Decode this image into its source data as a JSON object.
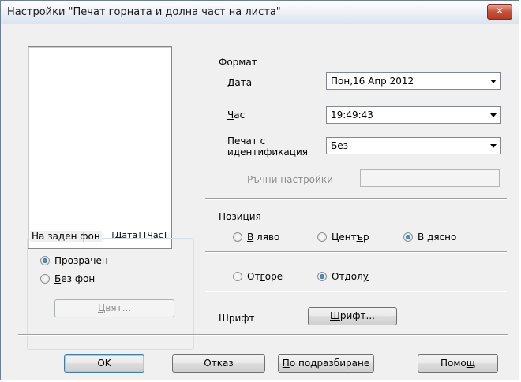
{
  "window": {
    "title": "Настройки \"Печат горната и долна част на листа\"",
    "close_label": "✕"
  },
  "preview": {
    "text": "[Дата] [Час]"
  },
  "background": {
    "label": "На заден фон",
    "options": [
      {
        "pre": "Прозрач",
        "u": "е",
        "post": "н",
        "selected": true
      },
      {
        "pre": "",
        "u": "Б",
        "post": "ез фон",
        "selected": false
      }
    ],
    "color_button": {
      "pre": "",
      "u": "Ц",
      "post": "вят..."
    }
  },
  "format": {
    "label": "Формат",
    "date": {
      "pre": "",
      "u": "Д",
      "post": "ата",
      "value": "Пон,16 Апр 2012"
    },
    "time": {
      "pre": "",
      "u": "Ч",
      "post": "ас",
      "value": "19:49:43"
    },
    "identification": {
      "label": "Печат с\nидентификация",
      "value": "Без"
    },
    "manual": {
      "pre": "Ръчни нас",
      "u": "т",
      "post": "ройки",
      "value": ""
    }
  },
  "position": {
    "label": "Позиция",
    "horizontal": [
      {
        "pre": "",
        "u": "В",
        "post": " ляво",
        "selected": false
      },
      {
        "pre": "Цент",
        "u": "ъ",
        "post": "р",
        "selected": false
      },
      {
        "pre": "В ",
        "u": "д",
        "post": "ясно",
        "selected": true
      }
    ],
    "vertical": [
      {
        "pre": "От",
        "u": "г",
        "post": "оре",
        "selected": false
      },
      {
        "pre": "Отдол",
        "u": "у",
        "post": "",
        "selected": true
      }
    ]
  },
  "font": {
    "label": "Шрифт",
    "button": {
      "pre": "",
      "u": "Ш",
      "post": "рифт..."
    }
  },
  "footer": {
    "ok": "OK",
    "cancel": "Отказ",
    "default": {
      "pre": "",
      "u": "П",
      "post": "о подразбиране"
    },
    "help": {
      "pre": "Помо",
      "u": "щ",
      "post": ""
    }
  },
  "colors": {
    "title_close": "#c9503a",
    "radio_dot": "#14509a"
  }
}
